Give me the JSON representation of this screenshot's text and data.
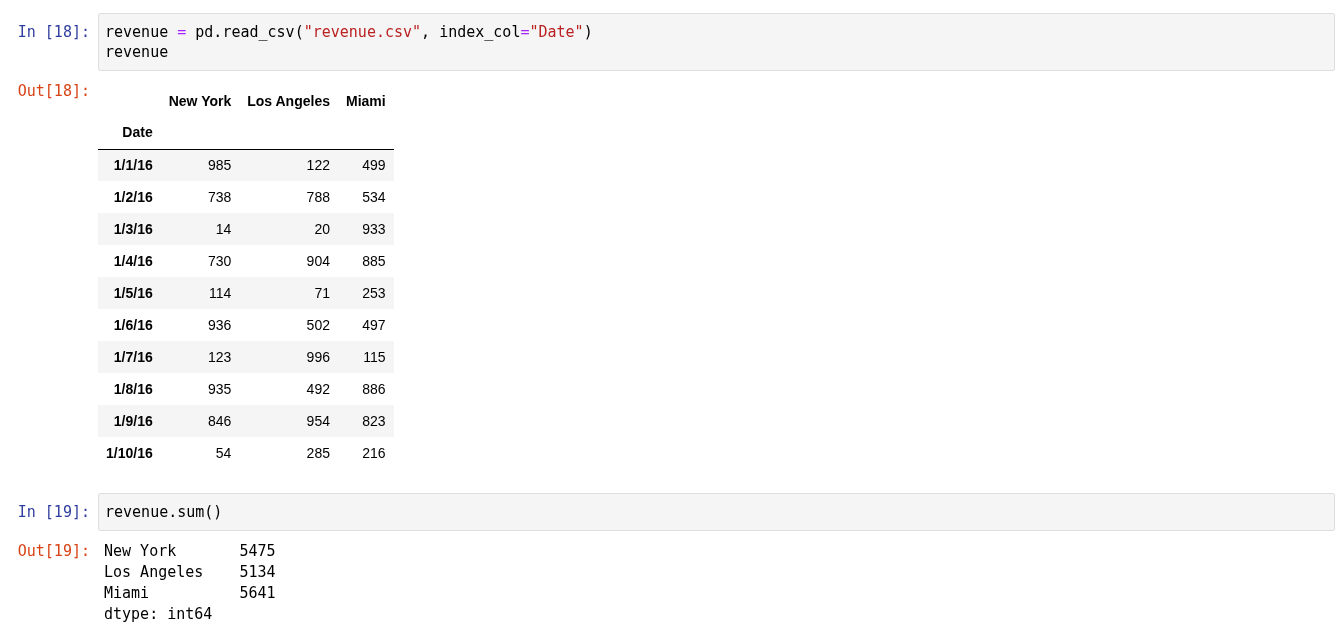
{
  "cells": [
    {
      "input_prompt": "In [18]:",
      "code": [
        [
          {
            "kind": "name",
            "text": "revenue "
          },
          {
            "kind": "op",
            "text": "="
          },
          {
            "kind": "name",
            "text": " pd.read_csv("
          },
          {
            "kind": "str",
            "text": "\"revenue.csv\""
          },
          {
            "kind": "name",
            "text": ", index_col"
          },
          {
            "kind": "op",
            "text": "="
          },
          {
            "kind": "str",
            "text": "\"Date\""
          },
          {
            "kind": "name",
            "text": ")"
          }
        ],
        [
          {
            "kind": "name",
            "text": "revenue"
          }
        ]
      ],
      "output_prompt": "Out[18]:",
      "output": {
        "kind": "table",
        "columns": [
          "New York",
          "Los Angeles",
          "Miami"
        ],
        "index_name": "Date",
        "rows": [
          {
            "index": "1/1/16",
            "values": [
              "985",
              "122",
              "499"
            ]
          },
          {
            "index": "1/2/16",
            "values": [
              "738",
              "788",
              "534"
            ]
          },
          {
            "index": "1/3/16",
            "values": [
              "14",
              "20",
              "933"
            ]
          },
          {
            "index": "1/4/16",
            "values": [
              "730",
              "904",
              "885"
            ]
          },
          {
            "index": "1/5/16",
            "values": [
              "114",
              "71",
              "253"
            ]
          },
          {
            "index": "1/6/16",
            "values": [
              "936",
              "502",
              "497"
            ]
          },
          {
            "index": "1/7/16",
            "values": [
              "123",
              "996",
              "115"
            ]
          },
          {
            "index": "1/8/16",
            "values": [
              "935",
              "492",
              "886"
            ]
          },
          {
            "index": "1/9/16",
            "values": [
              "846",
              "954",
              "823"
            ]
          },
          {
            "index": "1/10/16",
            "values": [
              "54",
              "285",
              "216"
            ]
          }
        ]
      }
    },
    {
      "input_prompt": "In [19]:",
      "code": [
        [
          {
            "kind": "name",
            "text": "revenue.sum()"
          }
        ]
      ],
      "output_prompt": "Out[19]:",
      "output": {
        "kind": "text",
        "lines": [
          "New York       5475",
          "Los Angeles    5134",
          "Miami          5641",
          "dtype: int64"
        ]
      }
    }
  ]
}
